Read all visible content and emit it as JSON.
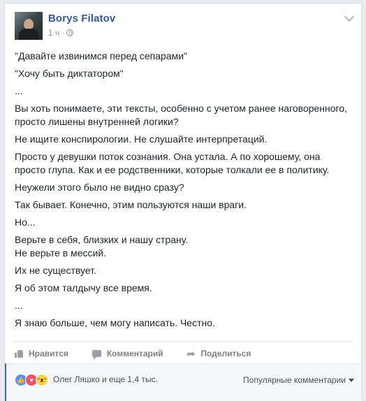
{
  "post": {
    "author": "Borys Filatov",
    "time": "1 ч",
    "separator": "·",
    "paragraphs": [
      "\"Давайте извинимся перед сепарами\"",
      "\"Хочу быть диктатором\"",
      "...",
      "Вы хоть понимаете, эти тексты, особенно с учетом ранее наговоренного, просто лишены внутренней логики?",
      "Не ищите конспирологии. Не слушайте интерпретаций.",
      "Просто у девушки поток сознания. Она устала. А по хорошему, она просто глупа. Как и ее родственники, которые толкали ее в политику.",
      "Неужели этого было не видно сразу?",
      "Так бывает. Конечно, этим пользуются наши враги.",
      "Но...",
      "Верьте в себя, близких и нашу страну.\nНе верьте в мессий.",
      "Их не существует.",
      "Я об этом талдычу все время.",
      "...",
      "Я знаю больше, чем могу написать. Честно."
    ]
  },
  "actions": {
    "like": "Нравится",
    "comment": "Комментарий",
    "share": "Поделиться"
  },
  "footer": {
    "reactions_text": "Олег Ляшко и еще 1,4 тыс.",
    "sort_label": "Популярные комментарии"
  },
  "icons": {
    "like": "like-icon",
    "comment": "comment-icon",
    "share": "share-icon",
    "globe": "globe-icon",
    "menu": "chevron-down-icon"
  },
  "colors": {
    "name": "#365899",
    "accent": "#4267b2",
    "text": "#1d2129",
    "meta": "#90949c"
  }
}
